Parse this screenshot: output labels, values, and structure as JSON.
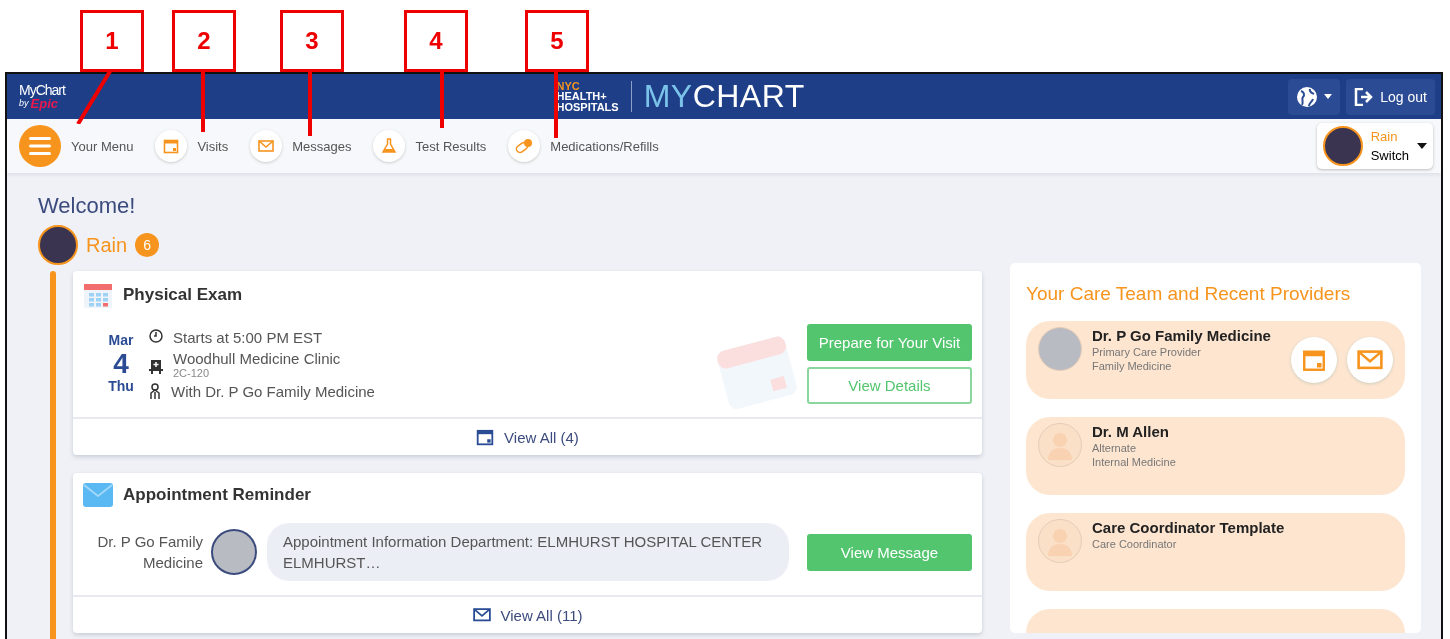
{
  "callouts": [
    {
      "label": "1"
    },
    {
      "label": "2"
    },
    {
      "label": "3"
    },
    {
      "label": "4"
    },
    {
      "label": "5"
    }
  ],
  "header": {
    "logo_top": "MyChart",
    "logo_by": "by",
    "logo_brand": "Epic",
    "org_line_1": "NYC",
    "org_line_2": "HEALTH+",
    "org_line_3": "HOSPITALS",
    "title_accent": "MY",
    "title_rest": "CHART",
    "logout": "Log out"
  },
  "nav": [
    {
      "kind": "menu",
      "label": "Your Menu"
    },
    {
      "kind": "calendar",
      "label": "Visits"
    },
    {
      "kind": "mail",
      "label": "Messages"
    },
    {
      "kind": "flask",
      "label": "Test Results"
    },
    {
      "kind": "pill",
      "label": "Medications/Refills"
    }
  ],
  "switcher": {
    "name": "Rain",
    "action": "Switch"
  },
  "welcome": {
    "title": "Welcome!",
    "user": "Rain",
    "badge": "6"
  },
  "cards": [
    {
      "kind": "visit",
      "title": "Physical Exam",
      "month": "Mar",
      "day": "4",
      "weekday": "Thu",
      "time": "Starts at 5:00 PM EST",
      "location": "Woodhull Medicine Clinic",
      "room": "2C-120",
      "provider": "With Dr. P Go Family Medicine",
      "primary_button": "Prepare for Your Visit",
      "secondary_button": "View Details",
      "footer": "View All (4)"
    },
    {
      "kind": "message",
      "title": "Appointment Reminder",
      "sender": "Dr. P Go Family Medicine",
      "preview": "Appointment Information Department: ELMHURST HOSPITAL CENTER ELMHURST…",
      "primary_button": "View Message",
      "footer": "View All (11)"
    }
  ],
  "care_team": {
    "title": "Your Care Team and Recent Providers",
    "providers": [
      {
        "name": "Dr. P Go Family Medicine",
        "has_photo": true,
        "details": [
          "Primary Care Provider",
          "Family Medicine"
        ],
        "actions": true
      },
      {
        "name": "Dr. M Allen",
        "has_photo": false,
        "details": [
          "Alternate",
          "Internal Medicine"
        ],
        "actions": false
      },
      {
        "name": "Care Coordinator Template",
        "has_photo": false,
        "details": [
          "Care Coordinator"
        ],
        "actions": false
      }
    ]
  }
}
